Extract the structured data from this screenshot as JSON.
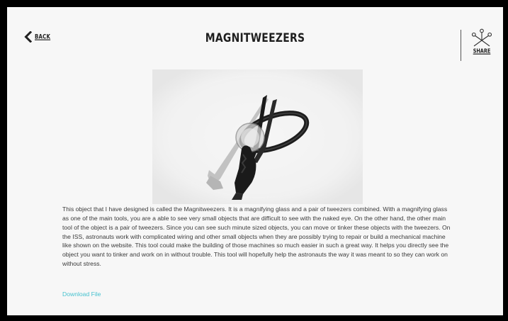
{
  "header": {
    "back_label": "BACK",
    "title": "MAGNITWEEZERS",
    "share_label": "SHARE"
  },
  "icons": {
    "back": "chevron-left-icon",
    "share": "share-network-icon"
  },
  "image": {
    "alt": "Magnitweezers 3D model"
  },
  "description": "This object that I have designed is called the Magnitweezers. It is a magnifying glass and a pair of tweezers combined. With a magnifying glass as one of the main tools, you are a able to see very small objects that are difficult to see with the naked eye. On the other hand, the other main tool of the object is a pair of tweezers. Since you can see such minute sized objects, you can move or tinker these objects with the tweezers. On the ISS, astronauts work with complicated wiring and other small objects when they are possibly trying to repair or build a mechanical machine like shown on the website. This tool could make the building of those machines so much easier in such a great way. It helps you directly see the object you want to tinker and work on in without trouble. This tool will hopefully help the astronauts the way it was meant to so they can work on without stress.",
  "download_label": "Download File",
  "colors": {
    "accent": "#46c2cf",
    "background": "#f7f7f7",
    "frame": "#000000"
  }
}
